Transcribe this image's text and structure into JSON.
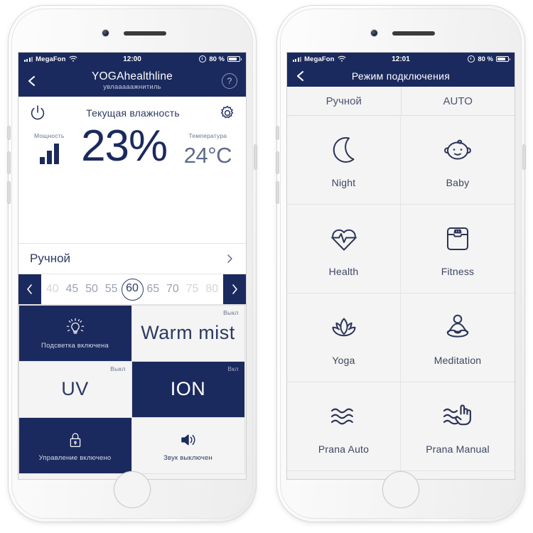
{
  "phones": {
    "left": {
      "statusbar": {
        "carrier": "MegaFon",
        "time": "12:00",
        "battery_pct": "80 %",
        "signal_icon": "signal-bars-icon",
        "wifi_icon": "wifi-icon",
        "alarm_icon": "alarm-clock-icon",
        "battery_icon": "battery-icon"
      },
      "navbar": {
        "back_icon": "chevron-left-icon",
        "title": "YOGAhealthline",
        "subtitle": "увлааааажнитиль",
        "help_label": "?",
        "help_icon": "help-circle-icon"
      },
      "main": {
        "power_icon": "power-icon",
        "title": "Текущая влажность",
        "settings_icon": "gear-icon",
        "power_label": "Мощность",
        "power_level_icon": "signal-bars-icon",
        "humidity_value": "23%",
        "temp_label": "Температура",
        "temp_value": "24°C"
      },
      "mode_row": {
        "label": "Ручной",
        "chevron_icon": "chevron-right-icon"
      },
      "slider": {
        "left_arrow_icon": "chevron-left-icon",
        "right_arrow_icon": "chevron-right-icon",
        "selected": "60",
        "values": [
          "40",
          "45",
          "50",
          "55",
          "60",
          "65",
          "70",
          "75",
          "80"
        ]
      },
      "tiles": [
        {
          "name": "backlight",
          "state_label": "",
          "label": "Подсветка включена",
          "big": "",
          "icon": "lightbulb-icon",
          "on": true
        },
        {
          "name": "warm-mist",
          "state_label": "Выкл",
          "label": "",
          "big": "Warm mist",
          "icon": "",
          "on": false
        },
        {
          "name": "uv",
          "state_label": "Выкл",
          "label": "",
          "big": "UV",
          "icon": "",
          "on": false
        },
        {
          "name": "ion",
          "state_label": "Вкл",
          "label": "",
          "big": "ION",
          "icon": "",
          "on": true
        },
        {
          "name": "child-lock",
          "state_label": "",
          "label": "Управление включено",
          "big": "",
          "icon": "lock-icon",
          "on": true
        },
        {
          "name": "sound",
          "state_label": "",
          "label": "Звук выключен",
          "big": "",
          "icon": "speaker-icon",
          "on": false
        }
      ]
    },
    "right": {
      "statusbar": {
        "carrier": "MegaFon",
        "time": "12:01",
        "battery_pct": "80 %",
        "signal_icon": "signal-bars-icon",
        "wifi_icon": "wifi-icon",
        "alarm_icon": "alarm-clock-icon",
        "battery_icon": "battery-icon"
      },
      "navbar": {
        "back_icon": "chevron-left-icon",
        "title": "Режим подключения"
      },
      "tabs": [
        {
          "label": "Ручной"
        },
        {
          "label": "AUTO"
        }
      ],
      "modes": [
        {
          "label": "Night",
          "icon": "moon-icon"
        },
        {
          "label": "Baby",
          "icon": "baby-face-icon"
        },
        {
          "label": "Health",
          "icon": "heart-pulse-icon"
        },
        {
          "label": "Fitness",
          "icon": "weight-scale-icon"
        },
        {
          "label": "Yoga",
          "icon": "lotus-flower-icon"
        },
        {
          "label": "Meditation",
          "icon": "meditation-person-icon"
        },
        {
          "label": "Prana Auto",
          "icon": "waves-icon"
        },
        {
          "label": "Prana Manual",
          "icon": "waves-hand-icon"
        }
      ]
    }
  },
  "colors": {
    "navy": "#1b2a5e",
    "light": "#f4f4f4",
    "muted": "#6a7490"
  }
}
